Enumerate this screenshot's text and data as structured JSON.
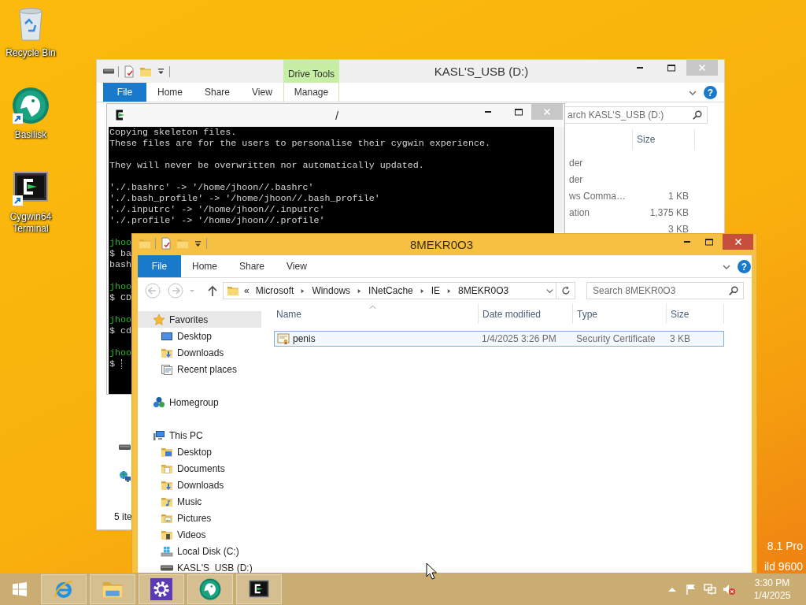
{
  "desktop": {
    "icons": [
      {
        "label": "Recycle Bin",
        "kind": "recycle-bin",
        "shortcut": false
      },
      {
        "label": "Basilisk",
        "kind": "basilisk",
        "shortcut": true
      },
      {
        "label": "Cygwin64 Terminal",
        "kind": "cygwin",
        "shortcut": true
      }
    ],
    "build_info": [
      "8.1 Pro",
      "ild 9600"
    ]
  },
  "drive_window": {
    "title": "KASL'S_USB (D:)",
    "active": false,
    "context_group": "Drive Tools",
    "ribbon_tabs": [
      {
        "label": "File",
        "kind": "file"
      },
      {
        "label": "Home",
        "kind": "tab"
      },
      {
        "label": "Share",
        "kind": "tab"
      },
      {
        "label": "View",
        "kind": "tab"
      },
      {
        "label": "Manage",
        "kind": "contextual"
      }
    ],
    "help": "?",
    "search": {
      "placeholder": "arch KASL'S_USB (D:)"
    },
    "columns": [
      "Size"
    ],
    "rows": [
      {
        "column_3": "der"
      },
      {
        "column_3": "der"
      },
      {
        "column_3": "ws Comma…",
        "size": "1 KB"
      },
      {
        "column_3": "ation",
        "size": "1,375 KB"
      },
      {
        "size": "3 KB"
      }
    ],
    "status": "5 ite"
  },
  "terminal": {
    "title": "/",
    "active": false,
    "cursor": true,
    "blocks": [
      [
        {
          "text": "Copying skeleton files.",
          "kind": "output"
        },
        {
          "text": "These files are for the users to personalise their cygwin experience.",
          "kind": "output"
        }
      ],
      [
        {
          "text": "They will never be overwritten nor automatically updated.",
          "kind": "output"
        }
      ],
      [
        {
          "text": "'./.bashrc' -> '/home/jhoon//.bashrc'",
          "kind": "output"
        },
        {
          "text": "'./.bash_profile' -> '/home/jhoon//.bash_profile'",
          "kind": "output"
        },
        {
          "text": "'./.inputrc' -> '/home/jhoon//.inputrc'",
          "kind": "output"
        },
        {
          "text": "'./.profile' -> '/home/jhoon//.profile'",
          "kind": "output"
        }
      ],
      [
        {
          "text": "jhoo",
          "kind": "prompt"
        },
        {
          "text": "$ ba",
          "kind": "output"
        },
        {
          "text": "bash",
          "kind": "output"
        }
      ],
      [
        {
          "text": "jhoo",
          "kind": "prompt"
        },
        {
          "text": "$ CD",
          "kind": "output"
        }
      ],
      [
        {
          "text": "jhoo",
          "kind": "prompt"
        },
        {
          "text": "$ cd",
          "kind": "output"
        }
      ],
      [
        {
          "text": "jhoo",
          "kind": "prompt"
        },
        {
          "text": "$",
          "kind": "output"
        }
      ]
    ]
  },
  "explorer": {
    "title": "8MEKR0O3",
    "active": true,
    "ribbon_tabs": [
      {
        "label": "File",
        "kind": "file"
      },
      {
        "label": "Home",
        "kind": "tab"
      },
      {
        "label": "Share",
        "kind": "tab"
      },
      {
        "label": "View",
        "kind": "tab"
      }
    ],
    "help": "?",
    "address": {
      "overflow": "«",
      "crumbs": [
        "Microsoft",
        "Windows",
        "INetCache",
        "IE",
        "8MEKR0O3"
      ]
    },
    "search": {
      "placeholder": "Search 8MEKR0O3"
    },
    "nav": [
      {
        "label": "Favorites",
        "kind": "star",
        "selected": true,
        "children": [
          {
            "label": "Desktop",
            "kind": "desktop",
            "selected": false
          },
          {
            "label": "Downloads",
            "kind": "downloads",
            "selected": false
          },
          {
            "label": "Recent places",
            "kind": "recent",
            "selected": false
          }
        ]
      },
      {
        "label": "Homegroup",
        "kind": "homegroup",
        "selected": false
      },
      {
        "label": "This PC",
        "kind": "pc",
        "selected": false,
        "children": [
          {
            "label": "Desktop",
            "kind": "desktop-folder",
            "selected": false
          },
          {
            "label": "Documents",
            "kind": "documents",
            "selected": false
          },
          {
            "label": "Downloads",
            "kind": "downloads",
            "selected": false
          },
          {
            "label": "Music",
            "kind": "music",
            "selected": false
          },
          {
            "label": "Pictures",
            "kind": "pictures",
            "selected": false
          },
          {
            "label": "Videos",
            "kind": "videos",
            "selected": false
          },
          {
            "label": "Local Disk (C:)",
            "kind": "disk",
            "selected": false
          },
          {
            "label": "KASL'S_USB (D:)",
            "kind": "usb",
            "selected": false
          }
        ]
      }
    ],
    "columns": [
      "Name",
      "Date modified",
      "Type",
      "Size"
    ],
    "files": [
      {
        "name": "penis",
        "date_modified": "1/4/2025 3:26 PM",
        "type": "Security Certificate",
        "size": "3 KB",
        "selected": true
      }
    ]
  },
  "taskbar": {
    "apps": [
      {
        "kind": "ie"
      },
      {
        "kind": "explorer"
      },
      {
        "kind": "settings"
      },
      {
        "kind": "basilisk"
      },
      {
        "kind": "cygwin"
      }
    ],
    "clock": {
      "time": "3:30 PM",
      "date": "1/4/2025"
    }
  }
}
